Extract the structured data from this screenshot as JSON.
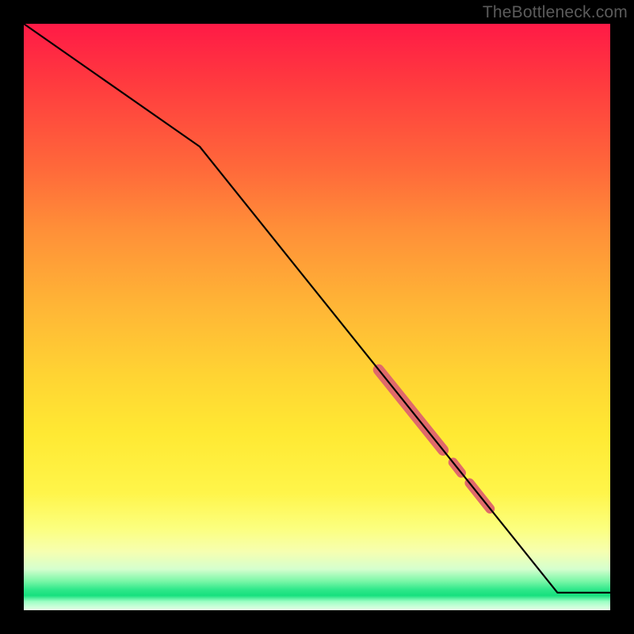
{
  "watermark": "TheBottleneck.com",
  "chart_data": {
    "type": "line",
    "title": "",
    "xlabel": "",
    "ylabel": "",
    "xlim": [
      0,
      100
    ],
    "ylim": [
      0,
      100
    ],
    "series": [
      {
        "name": "curve",
        "x": [
          0,
          30,
          91,
          100
        ],
        "y": [
          100,
          79,
          3,
          3
        ]
      }
    ],
    "highlights": [
      {
        "name": "segment-a",
        "x": [
          60.5,
          71.5
        ],
        "y": [
          41.0,
          27.3
        ]
      },
      {
        "name": "segment-b-dot",
        "x": [
          73.2,
          74.6
        ],
        "y": [
          25.2,
          23.4
        ]
      },
      {
        "name": "segment-c",
        "x": [
          76.0,
          79.5
        ],
        "y": [
          21.7,
          17.3
        ]
      }
    ],
    "gradient_stops": [
      {
        "pos": 0.0,
        "color": "#ff1a46"
      },
      {
        "pos": 0.5,
        "color": "#ffc934"
      },
      {
        "pos": 0.85,
        "color": "#fdff84"
      },
      {
        "pos": 0.97,
        "color": "#1fe481"
      },
      {
        "pos": 1.0,
        "color": "#eaffe8"
      }
    ]
  }
}
